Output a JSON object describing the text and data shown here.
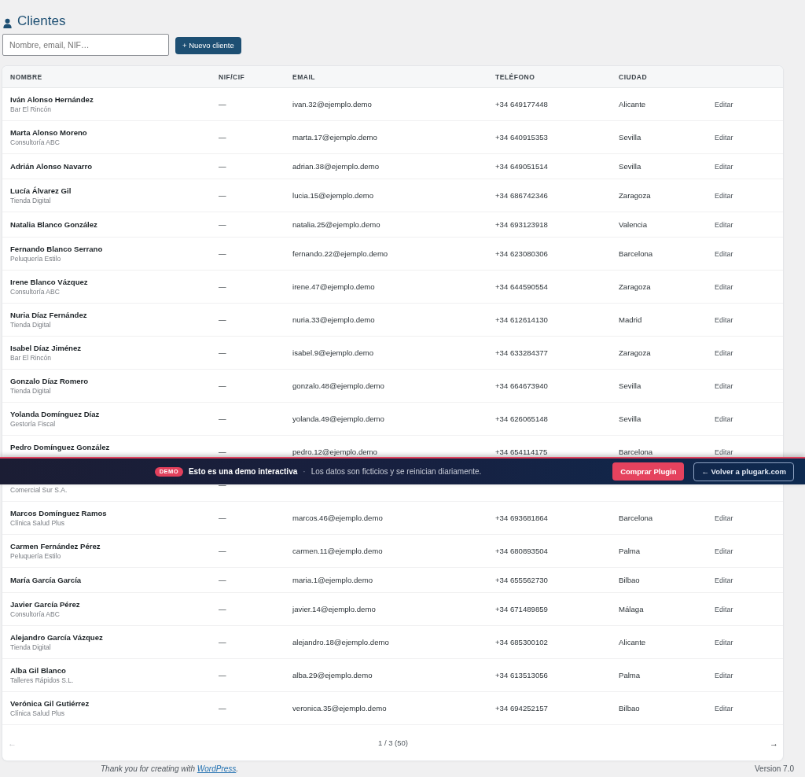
{
  "page": {
    "title": "Clientes"
  },
  "toolbar": {
    "search": {
      "placeholder": "Nombre, email, NIF…"
    },
    "new_button": "+ Nuevo cliente"
  },
  "table": {
    "columns": [
      "NOMBRE",
      "NIF/CIF",
      "EMAIL",
      "TELÉFONO",
      "CIUDAD"
    ],
    "rows": [
      {
        "kind": "double",
        "name": "Iván Alonso Hernández",
        "company": "Bar El Rincón",
        "nif": "—",
        "email": "ivan.32@ejemplo.demo",
        "phone": "+34 649177448",
        "city": "Alicante",
        "action": "Editar"
      },
      {
        "kind": "double",
        "name": "Marta Alonso Moreno",
        "company": "Consultoría ABC",
        "nif": "—",
        "email": "marta.17@ejemplo.demo",
        "phone": "+34 640915353",
        "city": "Sevilla",
        "action": "Editar"
      },
      {
        "kind": "single",
        "name": "Adrián Alonso Navarro",
        "nif": "—",
        "email": "adrian.38@ejemplo.demo",
        "phone": "+34 649051514",
        "city": "Sevilla",
        "action": "Editar"
      },
      {
        "kind": "double",
        "name": "Lucía Álvarez Gil",
        "company": "Tienda Digital",
        "nif": "—",
        "email": "lucia.15@ejemplo.demo",
        "phone": "+34 686742346",
        "city": "Zaragoza",
        "action": "Editar"
      },
      {
        "kind": "single",
        "name": "Natalia Blanco González",
        "nif": "—",
        "email": "natalia.25@ejemplo.demo",
        "phone": "+34 693123918",
        "city": "Valencia",
        "action": "Editar"
      },
      {
        "kind": "double",
        "name": "Fernando Blanco Serrano",
        "company": "Peluquería Estilo",
        "nif": "—",
        "email": "fernando.22@ejemplo.demo",
        "phone": "+34 623080306",
        "city": "Barcelona",
        "action": "Editar"
      },
      {
        "kind": "double",
        "name": "Irene Blanco Vázquez",
        "company": "Consultoría ABC",
        "nif": "—",
        "email": "irene.47@ejemplo.demo",
        "phone": "+34 644590554",
        "city": "Zaragoza",
        "action": "Editar"
      },
      {
        "kind": "double",
        "name": "Nuria Díaz Fernández",
        "company": "Tienda Digital",
        "nif": "—",
        "email": "nuria.33@ejemplo.demo",
        "phone": "+34 612614130",
        "city": "Madrid",
        "action": "Editar"
      },
      {
        "kind": "double",
        "name": "Isabel Díaz Jiménez",
        "company": "Bar El Rincón",
        "nif": "—",
        "email": "isabel.9@ejemplo.demo",
        "phone": "+34 633284377",
        "city": "Zaragoza",
        "action": "Editar"
      },
      {
        "kind": "double",
        "name": "Gonzalo Díaz Romero",
        "company": "Tienda Digital",
        "nif": "—",
        "email": "gonzalo.48@ejemplo.demo",
        "phone": "+34 664673940",
        "city": "Sevilla",
        "action": "Editar"
      },
      {
        "kind": "double",
        "name": "Yolanda Domínguez Díaz",
        "company": "Gestoría Fiscal",
        "nif": "—",
        "email": "yolanda.49@ejemplo.demo",
        "phone": "+34 626065148",
        "city": "Sevilla",
        "action": "Editar"
      },
      {
        "kind": "double",
        "name": "Pedro Domínguez González",
        "nif": "—",
        "email": "pedro.12@ejemplo.demo",
        "phone": "+34 654114175",
        "city": "Barcelona",
        "action": "Editar"
      },
      {
        "kind": "double",
        "company": "Comercial Sur S.A.",
        "nif": "—"
      },
      {
        "kind": "double",
        "name": "Marcos Domínguez Ramos",
        "company": "Clínica Salud Plus",
        "nif": "—",
        "email": "marcos.46@ejemplo.demo",
        "phone": "+34 693681864",
        "city": "Barcelona",
        "action": "Editar"
      },
      {
        "kind": "double",
        "name": "Carmen Fernández Pérez",
        "company": "Peluquería Estilo",
        "nif": "—",
        "email": "carmen.11@ejemplo.demo",
        "phone": "+34 680893504",
        "city": "Palma",
        "action": "Editar"
      },
      {
        "kind": "single",
        "name": "María García García",
        "nif": "—",
        "email": "maria.1@ejemplo.demo",
        "phone": "+34 655562730",
        "city": "Bilbao",
        "action": "Editar"
      },
      {
        "kind": "double",
        "name": "Javier García Pérez",
        "company": "Consultoría ABC",
        "nif": "—",
        "email": "javier.14@ejemplo.demo",
        "phone": "+34 671489859",
        "city": "Málaga",
        "action": "Editar"
      },
      {
        "kind": "double",
        "name": "Alejandro García Vázquez",
        "company": "Tienda Digital",
        "nif": "—",
        "email": "alejandro.18@ejemplo.demo",
        "phone": "+34 685300102",
        "city": "Alicante",
        "action": "Editar"
      },
      {
        "kind": "double",
        "name": "Alba Gil Blanco",
        "company": "Talleres Rápidos S.L.",
        "nif": "—",
        "email": "alba.29@ejemplo.demo",
        "phone": "+34 613513056",
        "city": "Palma",
        "action": "Editar"
      },
      {
        "kind": "double",
        "name": "Verónica Gil Gutiérrez",
        "company": "Clínica Salud Plus",
        "nif": "—",
        "email": "veronica.35@ejemplo.demo",
        "phone": "+34 694252157",
        "city": "Bilbao",
        "action": "Editar"
      }
    ],
    "pagination": {
      "prev": {
        "label": "←",
        "disabled": true
      },
      "status": "1 / 3 (50)",
      "next": {
        "label": "→",
        "disabled": false
      }
    }
  },
  "demo_banner": {
    "badge": "DEMO",
    "headline": "Esto es una demo interactiva",
    "separator": "·",
    "message": "Los datos son ficticios y se reinician diariamente.",
    "buttons": [
      {
        "label": "Comprar Plugin",
        "kind": "primary"
      },
      {
        "label": "← Volver a plugark.com",
        "kind": "outline"
      }
    ]
  },
  "footer": {
    "credit_text": "Thank you for creating with ",
    "credit_link": "WordPress",
    "credit_end": ".",
    "version": "Version 7.0"
  }
}
